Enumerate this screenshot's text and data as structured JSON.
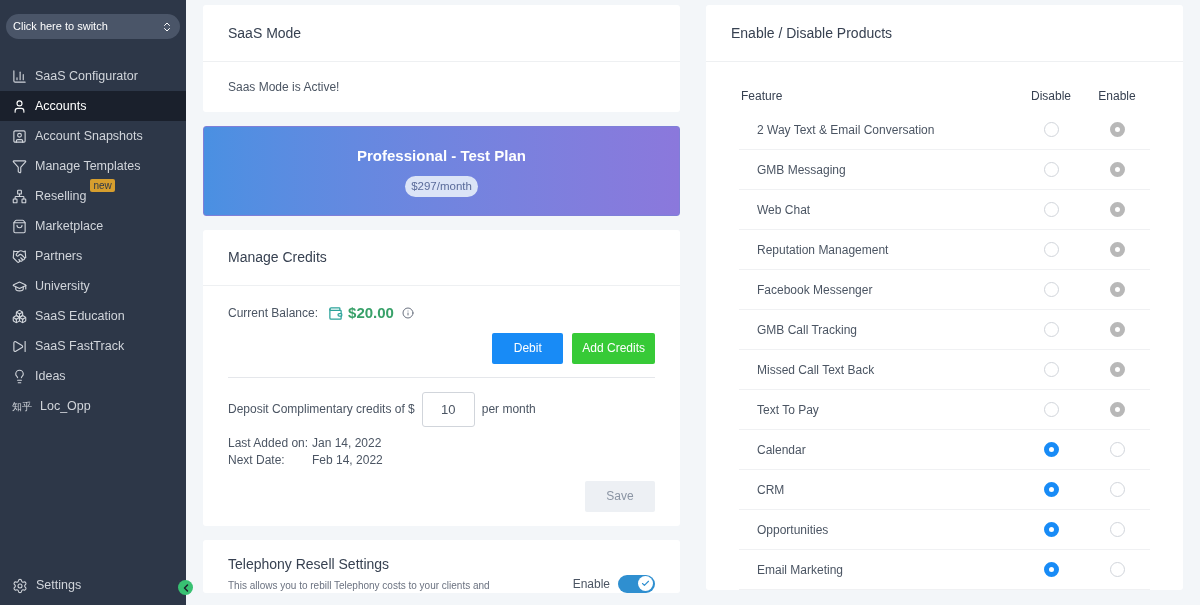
{
  "sidebar": {
    "switcher": {
      "label": "Click here to switch"
    },
    "items": [
      {
        "label": "SaaS Configurator",
        "selected": false
      },
      {
        "label": "Accounts",
        "selected": true
      },
      {
        "label": "Account Snapshots",
        "selected": false
      },
      {
        "label": "Manage Templates",
        "selected": false
      },
      {
        "label": "Reselling",
        "selected": false,
        "badge": "new"
      },
      {
        "label": "Marketplace",
        "selected": false
      },
      {
        "label": "Partners",
        "selected": false
      },
      {
        "label": "University",
        "selected": false
      },
      {
        "label": "SaaS Education",
        "selected": false
      },
      {
        "label": "SaaS FastTrack",
        "selected": false
      },
      {
        "label": "Ideas",
        "selected": false
      },
      {
        "label": "Loc_Opp",
        "icon_text": "知乎",
        "selected": false
      }
    ],
    "settings": {
      "label": "Settings"
    }
  },
  "saas_mode": {
    "title": "SaaS Mode",
    "status": "Saas Mode is Active!"
  },
  "plan": {
    "name": "Professional - Test Plan",
    "price": "$297/month"
  },
  "credits": {
    "title": "Manage Credits",
    "balance_label": "Current Balance:",
    "balance": "$20.00",
    "buttons": [
      "Debit",
      "Add Credits"
    ],
    "deposit_label": "Deposit Complimentary credits of $",
    "deposit_value": "10",
    "deposit_suffix": "per month",
    "last_added_label": "Last Added on:",
    "last_added": "Jan 14, 2022",
    "next_date_label": "Next Date:",
    "next_date": "Feb 14, 2022",
    "save": "Save"
  },
  "telephony": {
    "title": "Telephony Resell Settings",
    "description": "This allows you to rebill Telephony costs to your clients and",
    "toggle_label": "Enable",
    "on": true
  },
  "products": {
    "title": "Enable / Disable Products",
    "columns": [
      "Feature",
      "Disable",
      "Enable"
    ],
    "rows": [
      {
        "feature": "2 Way Text & Email Conversation",
        "locked": true,
        "options": [
          {
            "selected": false
          },
          {
            "selected": true
          }
        ]
      },
      {
        "feature": "GMB Messaging",
        "locked": true,
        "options": [
          {
            "selected": false
          },
          {
            "selected": true
          }
        ]
      },
      {
        "feature": "Web Chat",
        "locked": true,
        "options": [
          {
            "selected": false
          },
          {
            "selected": true
          }
        ]
      },
      {
        "feature": "Reputation Management",
        "locked": true,
        "options": [
          {
            "selected": false
          },
          {
            "selected": true
          }
        ]
      },
      {
        "feature": "Facebook Messenger",
        "locked": true,
        "options": [
          {
            "selected": false
          },
          {
            "selected": true
          }
        ]
      },
      {
        "feature": "GMB Call Tracking",
        "locked": true,
        "options": [
          {
            "selected": false
          },
          {
            "selected": true
          }
        ]
      },
      {
        "feature": "Missed Call Text Back",
        "locked": true,
        "options": [
          {
            "selected": false
          },
          {
            "selected": true
          }
        ]
      },
      {
        "feature": "Text To Pay",
        "locked": true,
        "options": [
          {
            "selected": false
          },
          {
            "selected": true
          }
        ]
      },
      {
        "feature": "Calendar",
        "locked": false,
        "options": [
          {
            "selected": true
          },
          {
            "selected": false
          }
        ]
      },
      {
        "feature": "CRM",
        "locked": false,
        "options": [
          {
            "selected": true
          },
          {
            "selected": false
          }
        ]
      },
      {
        "feature": "Opportunities",
        "locked": false,
        "options": [
          {
            "selected": true
          },
          {
            "selected": false
          }
        ]
      },
      {
        "feature": "Email Marketing",
        "locked": false,
        "options": [
          {
            "selected": true
          },
          {
            "selected": false
          }
        ]
      }
    ]
  }
}
